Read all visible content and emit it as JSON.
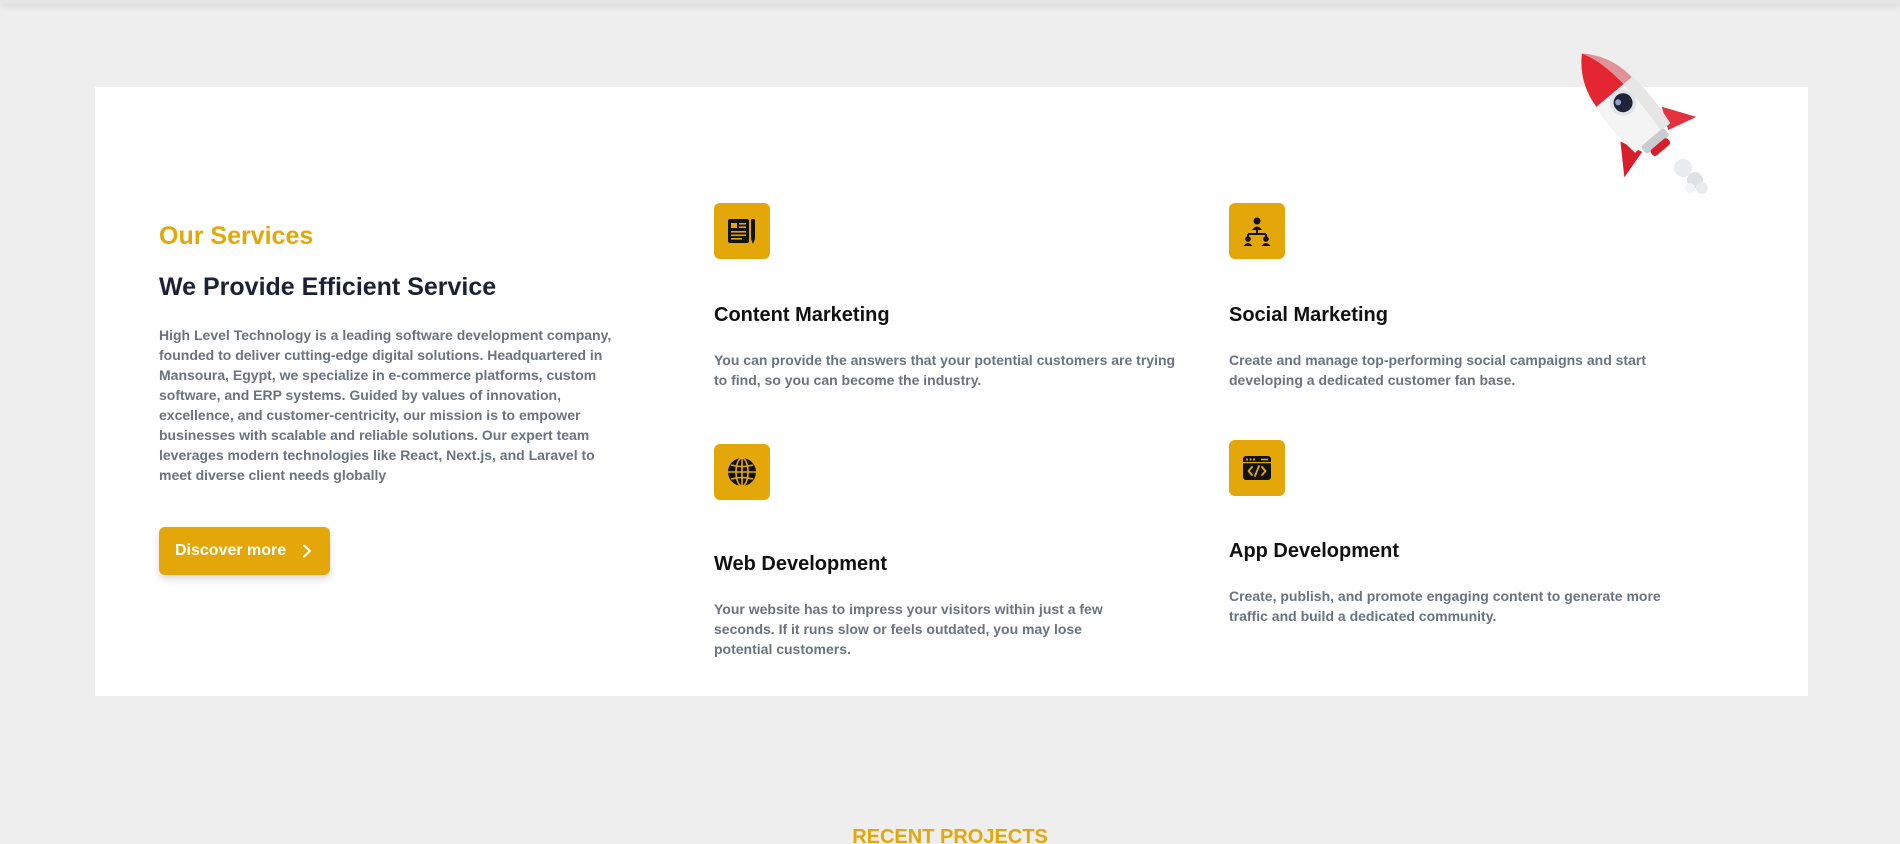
{
  "services_section": {
    "eyebrow": "Our Services",
    "headline": "We Provide Efficient Service",
    "intro": "High Level Technology is a leading software development company, founded to deliver cutting-edge digital solutions. Headquartered in Mansoura, Egypt, we specialize in e-commerce platforms, custom software, and ERP systems. Guided by values of innovation, excellence, and customer-centricity, our mission is to empower businesses with scalable and reliable solutions. Our expert team leverages modern technologies like React, Next.js, and Laravel to meet diverse client needs globally",
    "discover_button": "Discover more",
    "services": [
      {
        "icon": "content-marketing-icon",
        "title": "Content Marketing",
        "description": "You can provide the answers that your potential customers are trying to find, so you can become the industry."
      },
      {
        "icon": "social-network-icon",
        "title": "Social Marketing",
        "description": "Create and manage top-performing social campaigns and start developing a dedicated customer fan base."
      },
      {
        "icon": "globe-icon",
        "title": "Web Development",
        "description": "Your website has to impress your visitors within just a few seconds. If it runs slow or feels outdated, you may lose potential customers."
      },
      {
        "icon": "code-window-icon",
        "title": "App Development",
        "description": "Create, publish, and promote engaging content to generate more traffic and build a dedicated community."
      }
    ]
  },
  "next_section": {
    "label": "RECENT PROJECTS"
  },
  "colors": {
    "accent": "#e4a70a",
    "background": "#eeeeee",
    "card": "#ffffff",
    "heading": "#1a2238",
    "body_text": "#6b7280"
  }
}
